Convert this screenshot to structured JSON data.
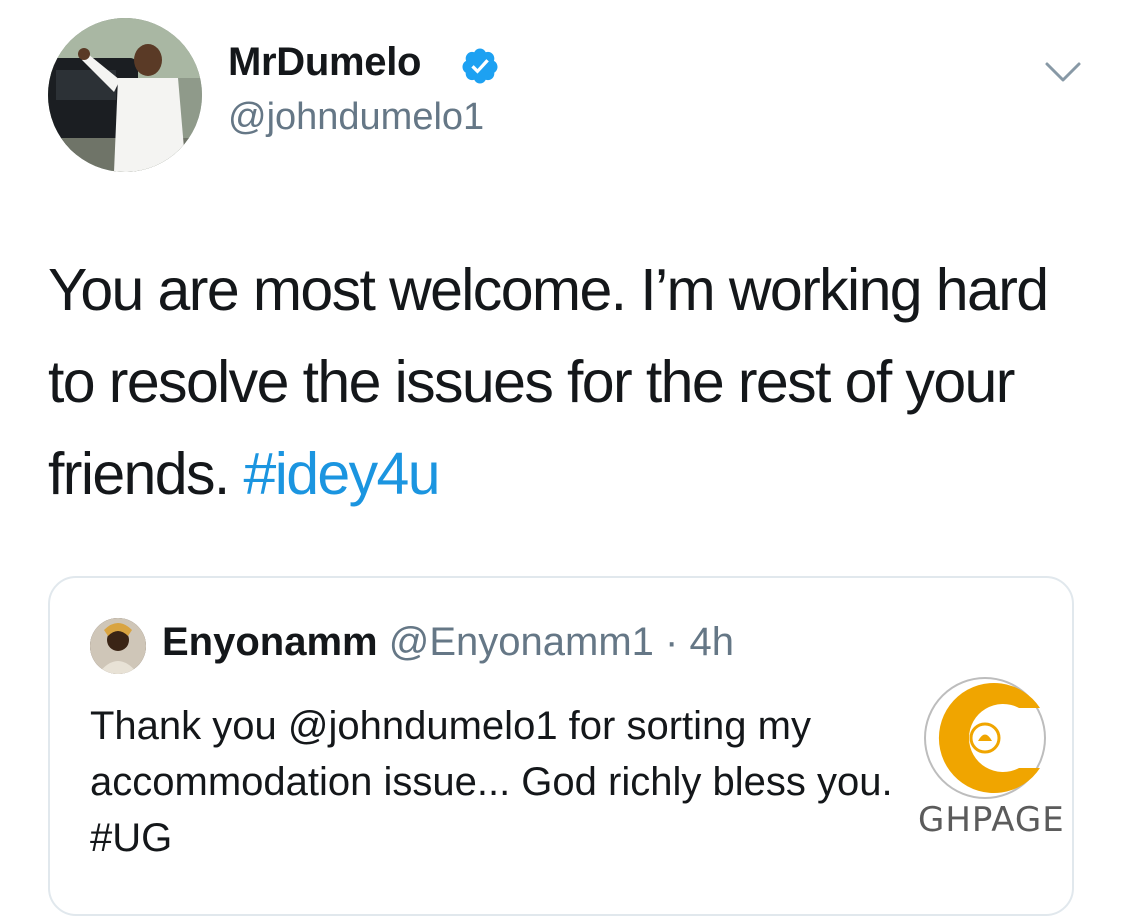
{
  "author": {
    "display_name": "MrDumelo",
    "handle": "@johndumelo1",
    "verified_icon": "verified-badge-icon"
  },
  "menu_icon": "chevron-down-icon",
  "tweet": {
    "text": "You are most welcome. I’m working hard to resolve the issues for the rest of your friends.",
    "hashtag": "#idey4u"
  },
  "quoted_tweet": {
    "display_name": "Enyonamm",
    "handle": "@Enyonamm1",
    "separator": "·",
    "time": "4h",
    "text": "Thank you @johndumelo1 for sorting my accommodation issue... God richly bless you.",
    "hashtag": "#UG"
  },
  "watermark": {
    "text": "GHPAGE"
  },
  "colors": {
    "link": "#1b95e0",
    "verified": "#1da1f2",
    "secondary_text": "#657786",
    "border": "#e1e8ed"
  }
}
